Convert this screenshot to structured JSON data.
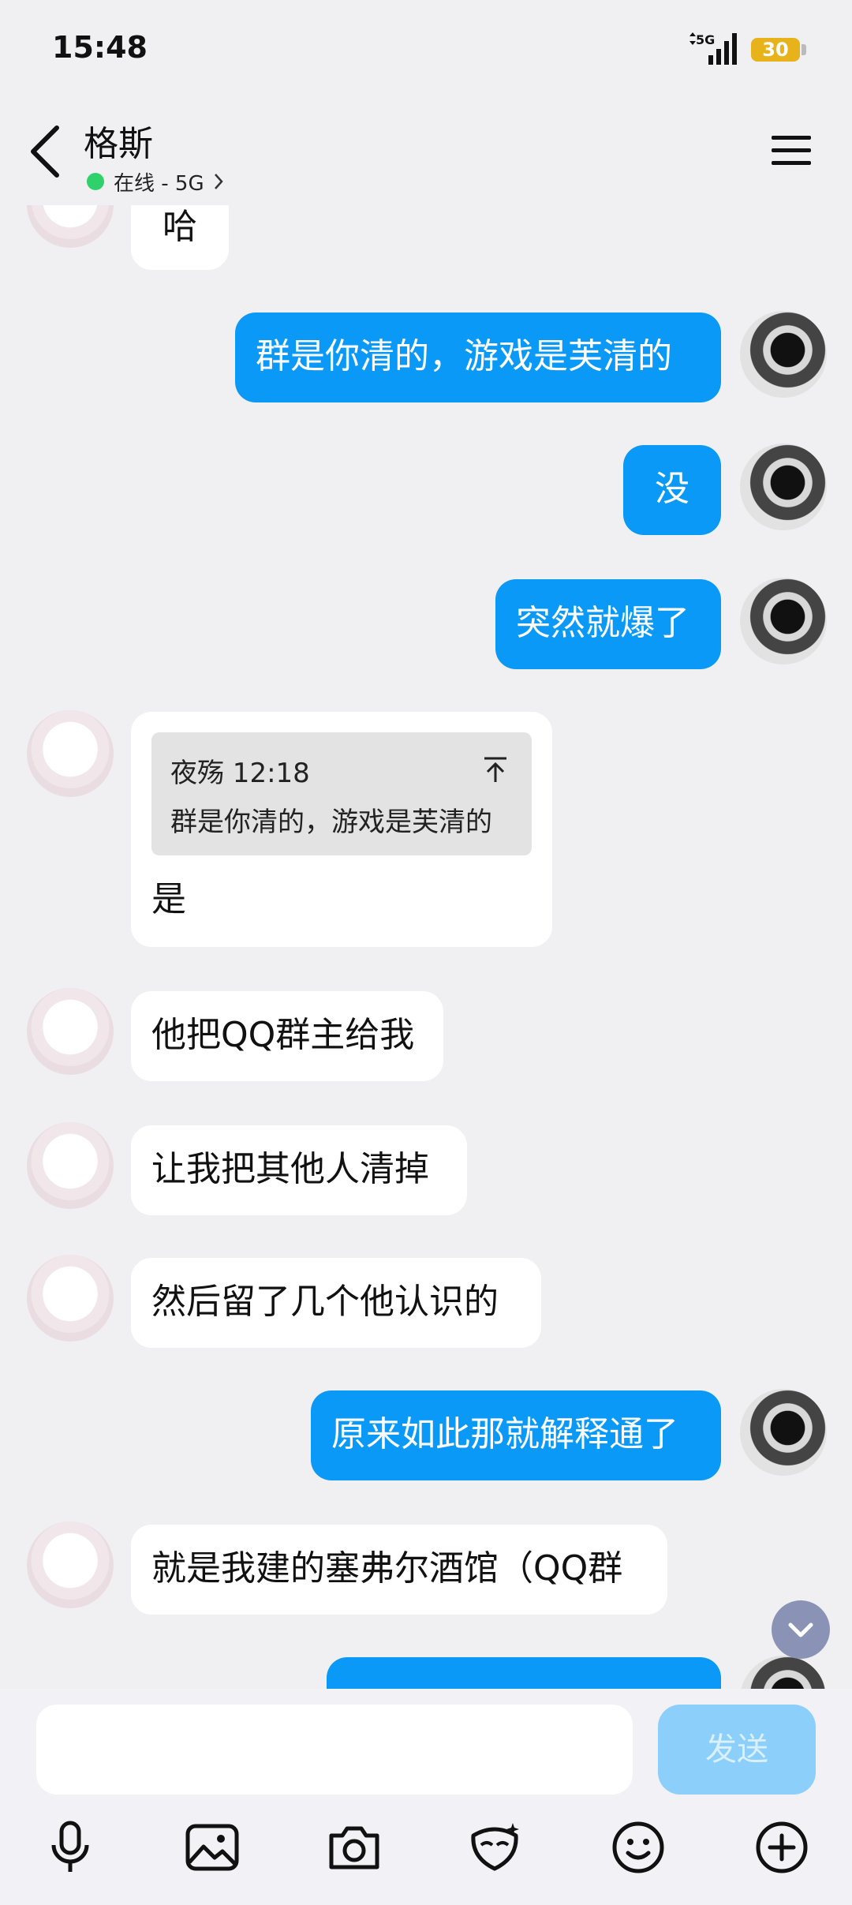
{
  "status": {
    "time": "15:48",
    "network": "5G",
    "battery": "30"
  },
  "header": {
    "title": "格斯",
    "presence": "在线 - 5G"
  },
  "messages": [
    {
      "side": "in",
      "text": "哈"
    },
    {
      "side": "out",
      "text": "群是你清的，游戏是芙清的"
    },
    {
      "side": "out",
      "text": "没"
    },
    {
      "side": "out",
      "text": "突然就爆了"
    },
    {
      "side": "in",
      "quote": {
        "author_time": "夜殇 12:18",
        "text": "群是你清的，游戏是芙清的"
      },
      "text": "是"
    },
    {
      "side": "in",
      "text": "他把QQ群主给我"
    },
    {
      "side": "in",
      "text": "让我把其他人清掉"
    },
    {
      "side": "in",
      "text": "然后留了几个他认识的"
    },
    {
      "side": "out",
      "text": "原来如此那就解释通了"
    },
    {
      "side": "in",
      "text": "就是我建的塞弗尔酒馆（QQ群"
    }
  ],
  "composer": {
    "input_value": "",
    "send_label": "发送"
  },
  "toolbar": [
    "microphone",
    "image",
    "camera",
    "sticker-creator",
    "emoji",
    "add"
  ],
  "colors": {
    "out_bubble": "#0b99f7",
    "in_bubble": "#ffffff",
    "online": "#2fd26a",
    "send_disabled": "#8ccffb"
  }
}
